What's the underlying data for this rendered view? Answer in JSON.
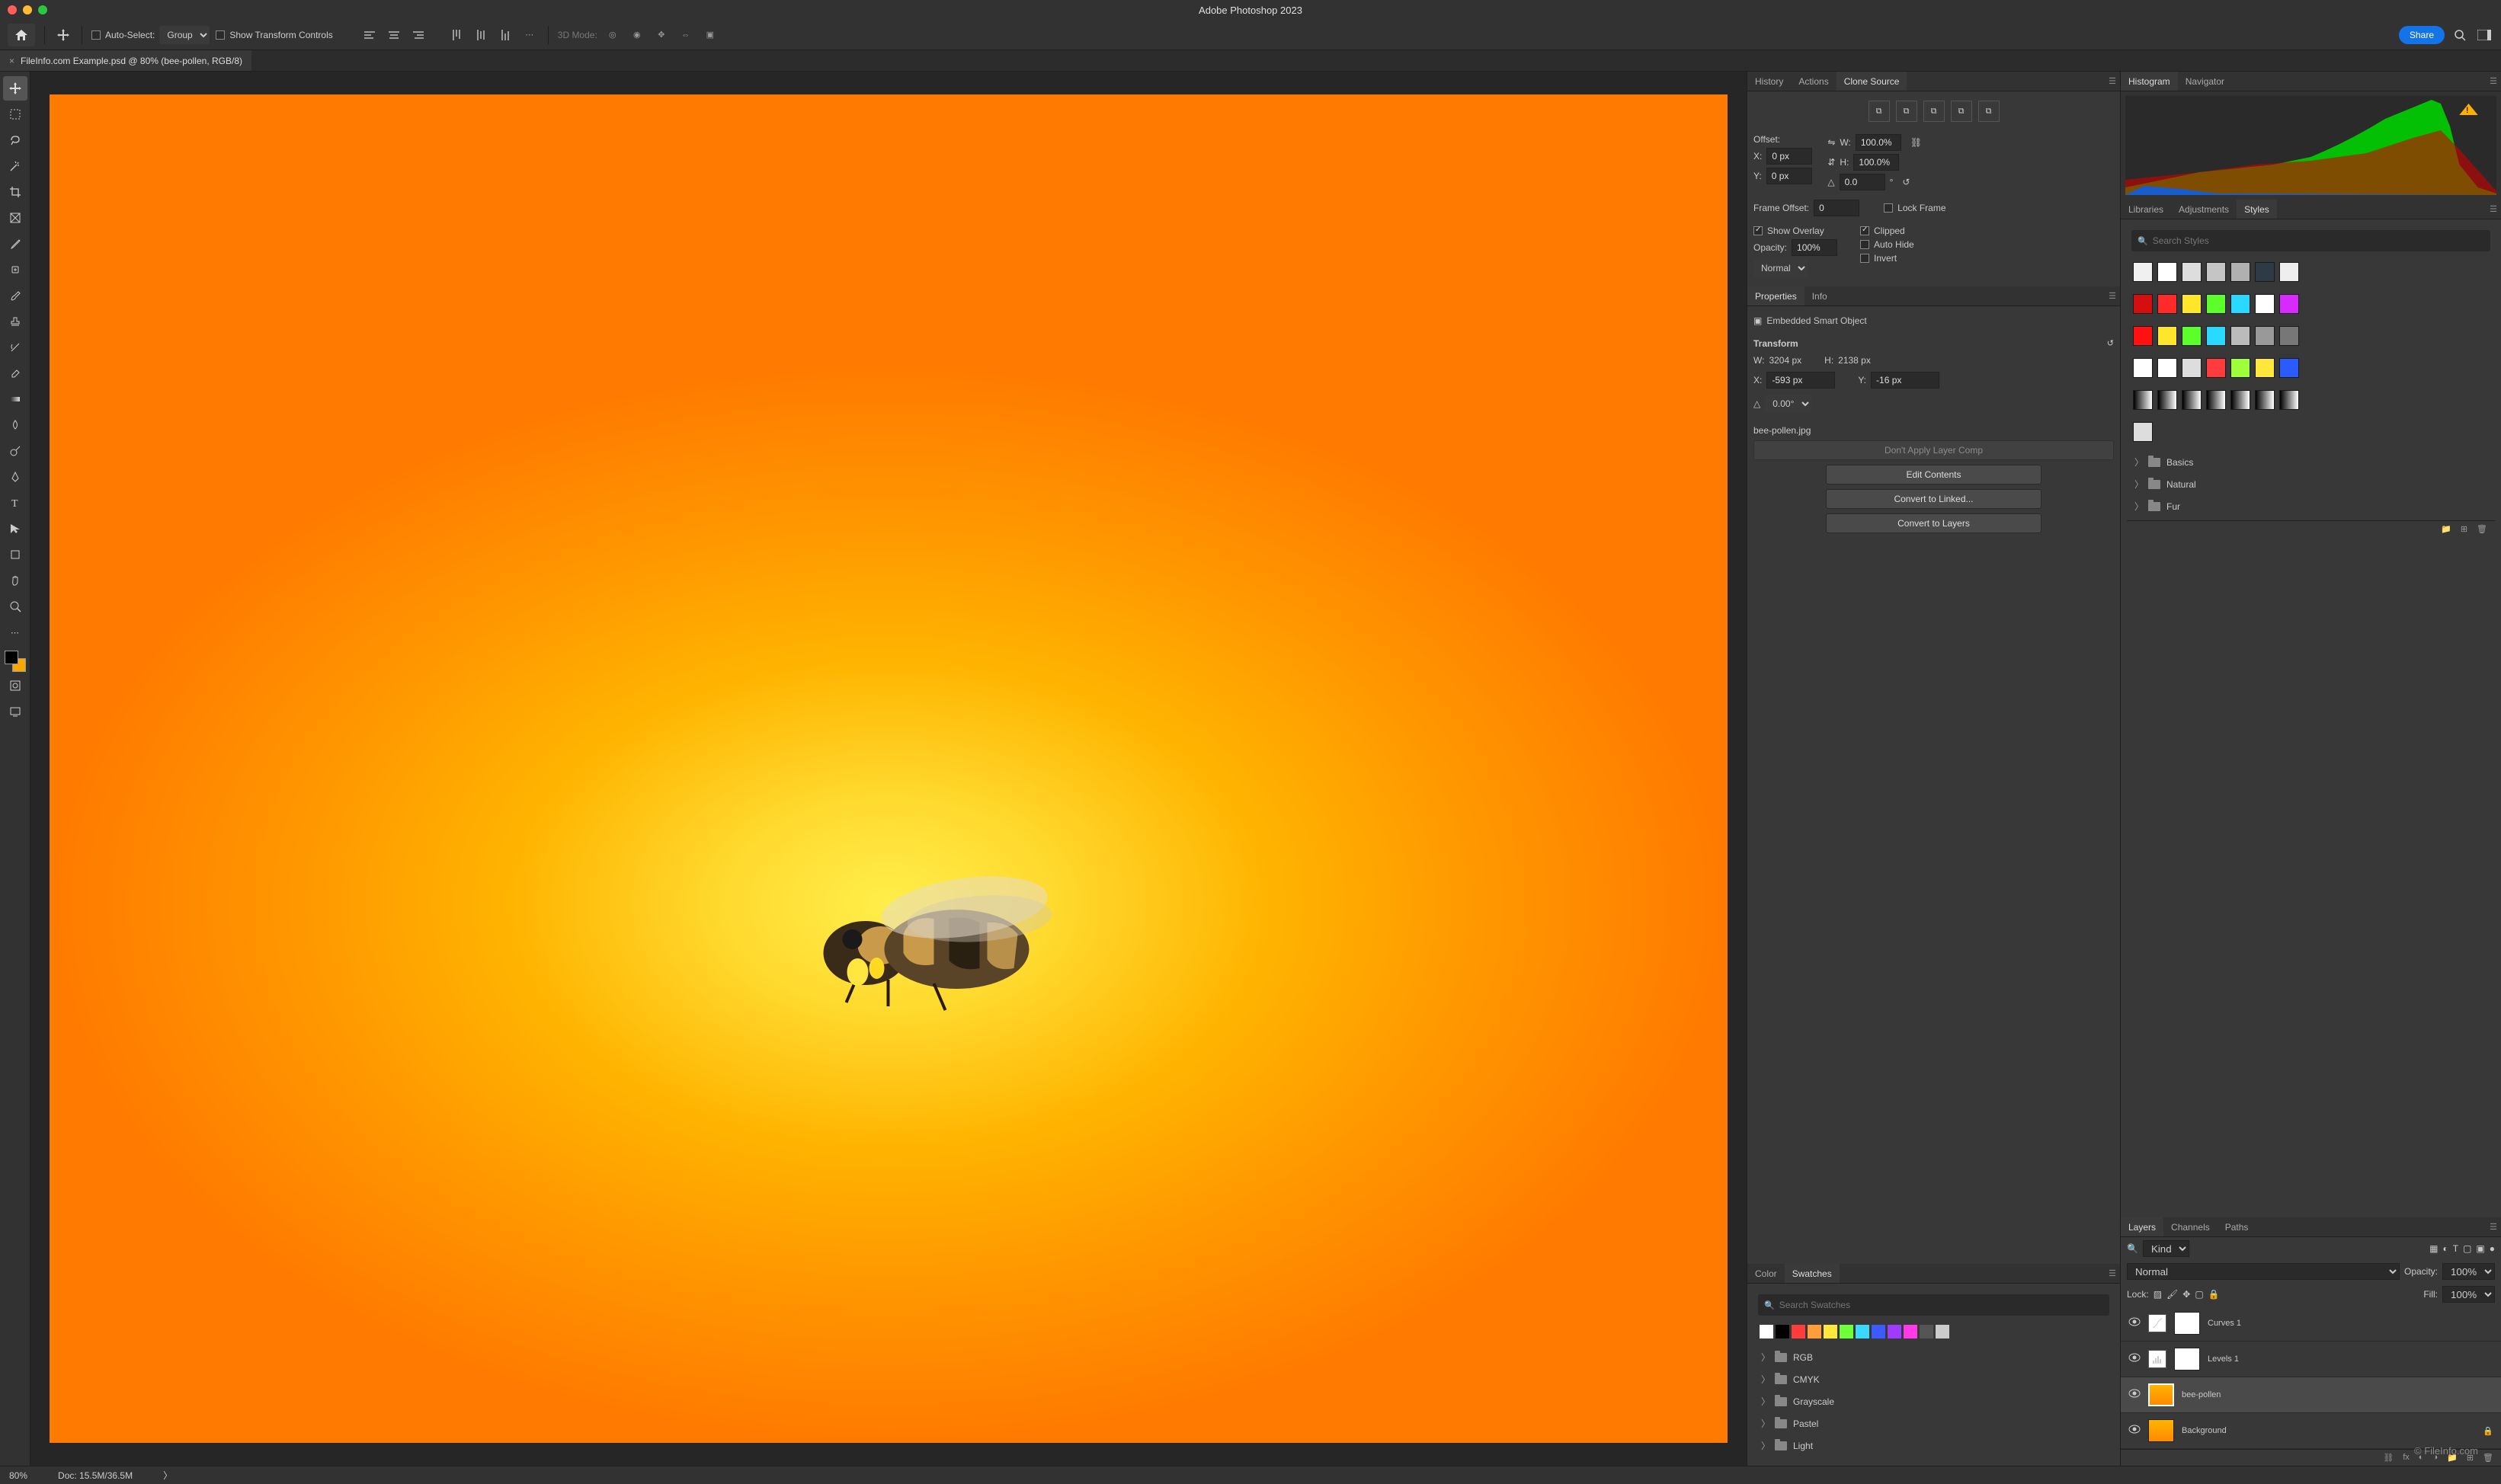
{
  "titlebar": {
    "title": "Adobe Photoshop 2023"
  },
  "optionsbar": {
    "autoSelectLabel": "Auto-Select:",
    "autoSelectValue": "Group",
    "showTransform": "Show Transform Controls",
    "mode3d": "3D Mode:",
    "share": "Share"
  },
  "documentTab": {
    "title": "FileInfo.com Example.psd @ 80% (bee-pollen, RGB/8)"
  },
  "statusbar": {
    "zoom": "80%",
    "docInfo": "Doc: 15.5M/36.5M"
  },
  "panels1": {
    "tabs": [
      "History",
      "Actions",
      "Clone Source"
    ],
    "activeTab": 2,
    "cloneSource": {
      "offsetLabel": "Offset:",
      "x": {
        "label": "X:",
        "value": "0 px"
      },
      "y": {
        "label": "Y:",
        "value": "0 px"
      },
      "w": {
        "label": "W:",
        "value": "100.0%"
      },
      "h": {
        "label": "H:",
        "value": "100.0%"
      },
      "angle": {
        "value": "0.0"
      },
      "frameOffset": {
        "label": "Frame Offset:",
        "value": "0"
      },
      "lockFrame": "Lock Frame",
      "showOverlay": "Show Overlay",
      "opacity": {
        "label": "Opacity:",
        "value": "100%"
      },
      "blend": "Normal",
      "clipped": "Clipped",
      "autoHide": "Auto Hide",
      "invert": "Invert"
    },
    "tabs2": [
      "Properties",
      "Info"
    ],
    "activeTab2": 0,
    "properties": {
      "kind": "Embedded Smart Object",
      "transformLabel": "Transform",
      "w": {
        "label": "W:",
        "value": "3204 px"
      },
      "h": {
        "label": "H:",
        "value": "2138 px"
      },
      "x": {
        "label": "X:",
        "value": "-593 px"
      },
      "y": {
        "label": "Y:",
        "value": "-16 px"
      },
      "angle": {
        "value": "0.00°"
      },
      "filename": "bee-pollen.jpg",
      "layerComp": "Don't Apply Layer Comp",
      "btnEdit": "Edit Contents",
      "btnLinked": "Convert to Linked...",
      "btnLayers": "Convert to Layers"
    },
    "tabs3": [
      "Color",
      "Swatches"
    ],
    "activeTab3": 1,
    "swatches": {
      "placeholder": "Search Swatches",
      "recent": [
        "#ffffff",
        "#000000",
        "#ff3b3b",
        "#ff9e3b",
        "#ffe83b",
        "#6eff3b",
        "#3bd9ff",
        "#3b5bff",
        "#9e3bff",
        "#ff3be8",
        "#555555",
        "#cccccc"
      ],
      "folders": [
        "RGB",
        "CMYK",
        "Grayscale",
        "Pastel",
        "Light"
      ]
    }
  },
  "panels2": {
    "tabs": [
      "Histogram",
      "Navigator"
    ],
    "activeTab": 0,
    "tabs2": [
      "Libraries",
      "Adjustments",
      "Styles"
    ],
    "activeTab2": 2,
    "styles": {
      "placeholder": "Search Styles",
      "swatches": [
        [
          "#f0f0f0",
          "#ffffff",
          "#dddddd",
          "#c5c5c5",
          "#b0b0b0",
          "#2e3a46",
          "#eeeeee"
        ],
        [
          "#d40f0f",
          "#ff2a2a",
          "#ffe62a",
          "#5dff2a",
          "#2ad9ff",
          "#ffffff",
          "#d62aff"
        ],
        [
          "#ff1111",
          "#ffe62a",
          "#5dff2a",
          "#2ad9ff",
          "#bbbbbb",
          "#999999",
          "#777777"
        ],
        [
          "#ffffff",
          "#ffffff",
          "#dddddd",
          "#ff3b3b",
          "#9eff3b",
          "#ffe83b",
          "#2a5bff"
        ]
      ],
      "gradients": [
        "g",
        "g",
        "g",
        "g",
        "g",
        "g",
        "g"
      ],
      "extra": [
        "#dddddd"
      ],
      "folders": [
        "Basics",
        "Natural",
        "Fur"
      ]
    },
    "tabs3": [
      "Layers",
      "Channels",
      "Paths"
    ],
    "activeTab3": 0,
    "layers": {
      "kind": "Kind",
      "blend": "Normal",
      "opacityLabel": "Opacity:",
      "opacityVal": "100%",
      "lockLabel": "Lock:",
      "fillLabel": "Fill:",
      "fillVal": "100%",
      "items": [
        {
          "name": "Curves 1",
          "type": "curves"
        },
        {
          "name": "Levels 1",
          "type": "levels"
        },
        {
          "name": "bee-pollen",
          "type": "smart",
          "selected": true
        },
        {
          "name": "Background",
          "type": "bg",
          "locked": true
        }
      ]
    },
    "watermark": "© FileInfo.com"
  },
  "tools": {
    "fg": "#000000",
    "bg": "#f6a800"
  }
}
